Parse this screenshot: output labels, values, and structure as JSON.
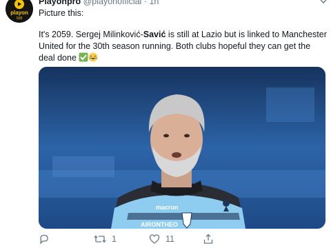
{
  "tweet": {
    "account": {
      "display_name": "Playonpro",
      "handle": "@playonofficial",
      "separator": "·",
      "time": "1h",
      "avatar_text": "playon",
      "avatar_subtext": "528"
    },
    "intro": "Picture this:",
    "body": {
      "part1": "It's 2059. Sergej Milinković-",
      "bold": "Savić",
      "part2": " is still at Lazio but is linked to Manchester United for the 30th season running. Both clubs hopeful they can get the deal done"
    },
    "emojis": [
      "check-mark-emoji",
      "laughing-emoji"
    ],
    "image": {
      "jersey_sponsor": "macron",
      "jersey_text": "AIRONTHEO"
    },
    "actions": {
      "reply_count": "",
      "retweet_count": "1",
      "like_count": "11",
      "share_count": ""
    }
  },
  "colors": {
    "accent_yellow": "#f5c400",
    "text_secondary": "#657786",
    "stadium_blue": "#1f4e8f",
    "jersey_blue": "#8ecdf0"
  }
}
